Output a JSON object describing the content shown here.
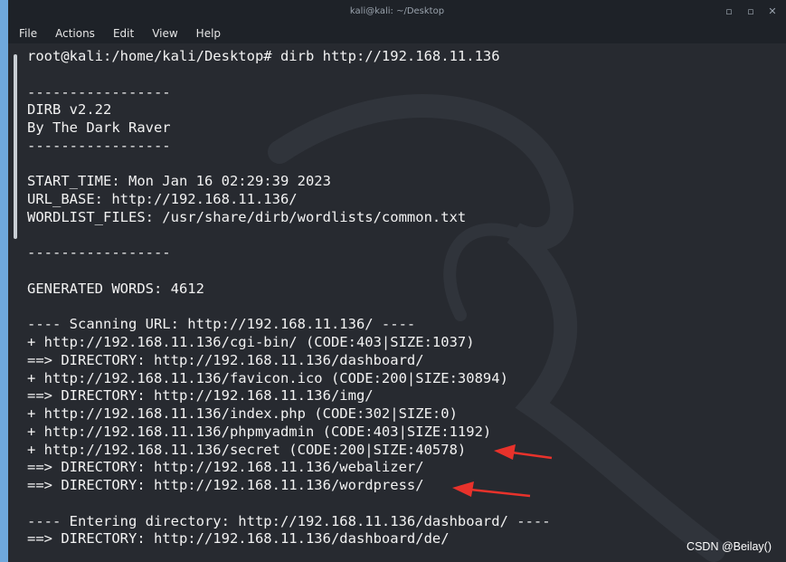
{
  "window": {
    "title": "kali@kali: ~/Desktop"
  },
  "controls": {
    "minimize": "▫",
    "maximize": "▫",
    "close": "✕"
  },
  "menu": [
    "File",
    "Actions",
    "Edit",
    "View",
    "Help"
  ],
  "terminal": {
    "lines": [
      "root@kali:/home/kali/Desktop# dirb http://192.168.11.136",
      "",
      "-----------------",
      "DIRB v2.22",
      "By The Dark Raver",
      "-----------------",
      "",
      "START_TIME: Mon Jan 16 02:29:39 2023",
      "URL_BASE: http://192.168.11.136/",
      "WORDLIST_FILES: /usr/share/dirb/wordlists/common.txt",
      "",
      "-----------------",
      "",
      "GENERATED WORDS: 4612",
      "",
      "---- Scanning URL: http://192.168.11.136/ ----",
      "+ http://192.168.11.136/cgi-bin/ (CODE:403|SIZE:1037)",
      "==> DIRECTORY: http://192.168.11.136/dashboard/",
      "+ http://192.168.11.136/favicon.ico (CODE:200|SIZE:30894)",
      "==> DIRECTORY: http://192.168.11.136/img/",
      "+ http://192.168.11.136/index.php (CODE:302|SIZE:0)",
      "+ http://192.168.11.136/phpmyadmin (CODE:403|SIZE:1192)",
      "+ http://192.168.11.136/secret (CODE:200|SIZE:40578)",
      "==> DIRECTORY: http://192.168.11.136/webalizer/",
      "==> DIRECTORY: http://192.168.11.136/wordpress/",
      "",
      "---- Entering directory: http://192.168.11.136/dashboard/ ----",
      "==> DIRECTORY: http://192.168.11.136/dashboard/de/"
    ]
  },
  "watermark": "CSDN @Beilay()",
  "colors": {
    "terminal_bg": "#272a30",
    "text": "#f2f2f2",
    "arrow": "#e8322b",
    "desktop": "#6fa8dc"
  }
}
